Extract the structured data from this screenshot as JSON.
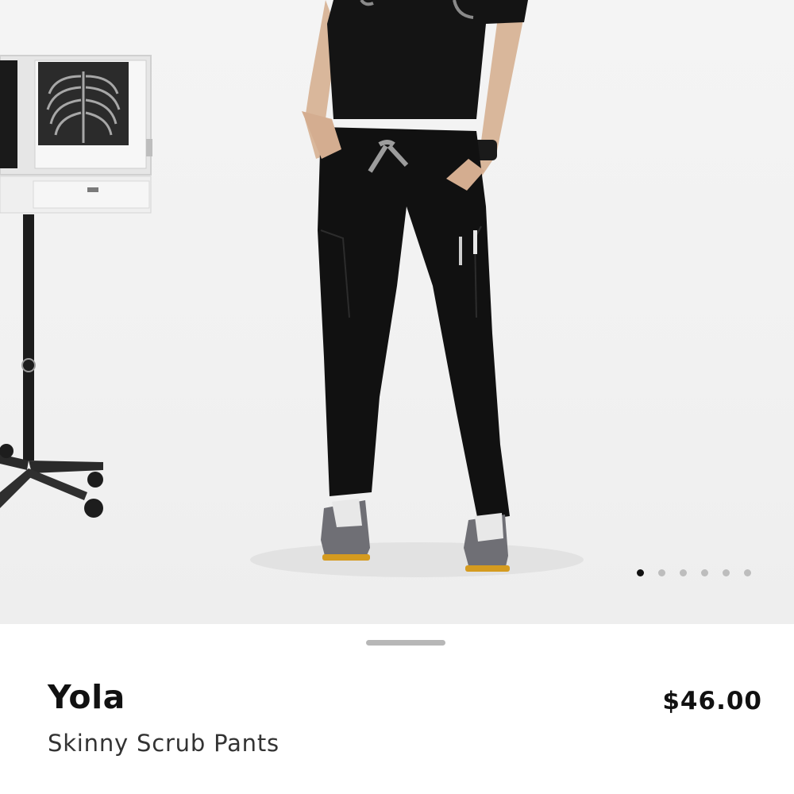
{
  "carousel": {
    "slide_count": 6,
    "active_index": 0
  },
  "product": {
    "name": "Yola",
    "subtitle": "Skinny Scrub Pants",
    "price": "$46.00"
  },
  "colors": {
    "garment": "#111111",
    "dot_active": "#111111",
    "dot_inactive": "#bdbdbd",
    "sheet_handle": "#b7b7b7"
  }
}
